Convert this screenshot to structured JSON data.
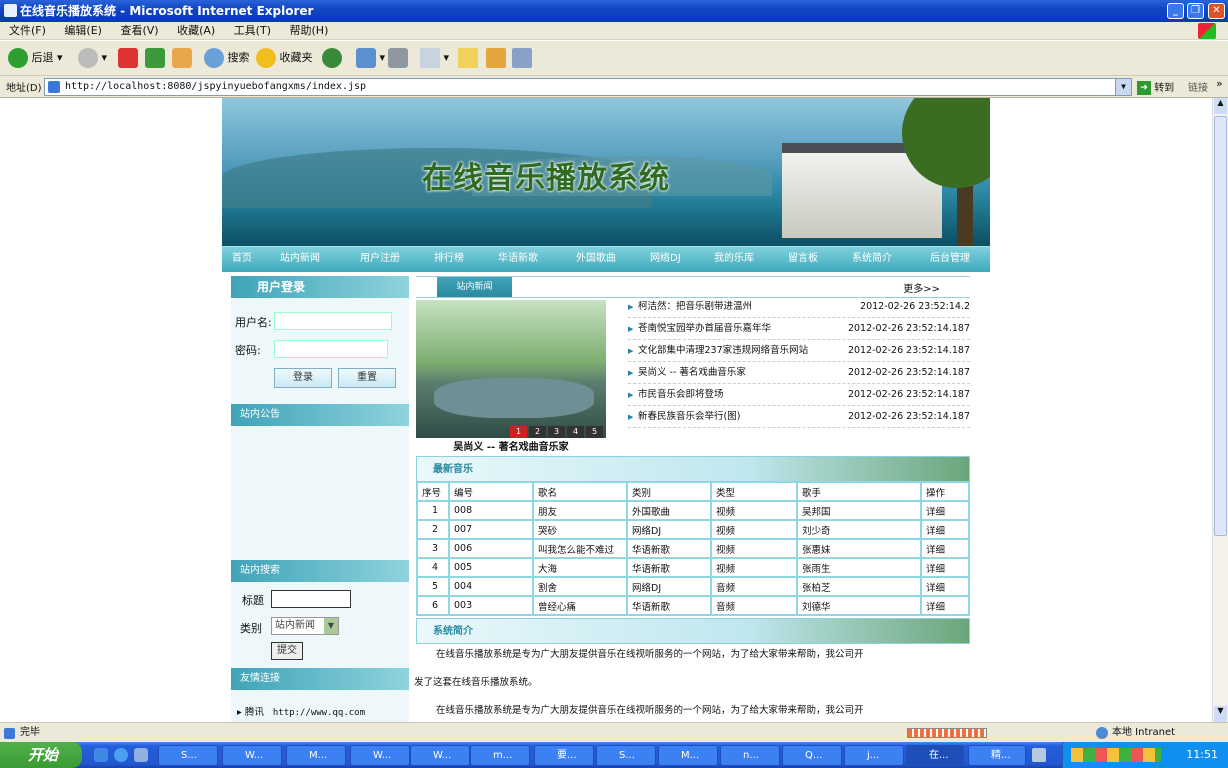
{
  "window": {
    "title": "在线音乐播放系统 - Microsoft Internet Explorer"
  },
  "menu": [
    "文件(F)",
    "编辑(E)",
    "查看(V)",
    "收藏(A)",
    "工具(T)",
    "帮助(H)"
  ],
  "toolbar": {
    "back": "后退",
    "search": "搜索",
    "favorites": "收藏夹"
  },
  "address": {
    "label": "地址(D)",
    "url": "http://localhost:8080/jspyinyuebofangxms/index.jsp",
    "go": "转到",
    "links": "链接"
  },
  "site": {
    "banner_title": "在线音乐播放系统",
    "nav": [
      "首页",
      "站内新闻",
      "用户注册",
      "排行榜",
      "华语新歌",
      "外国歌曲",
      "网络DJ",
      "我的乐库",
      "留言板",
      "系统简介",
      "后台管理"
    ],
    "login": {
      "header": "用户登录",
      "username_label": "用户名:",
      "password_label": "密码:",
      "login_btn": "登录",
      "reset_btn": "重置"
    },
    "notice": {
      "header": "站内公告"
    },
    "search": {
      "header": "站内搜索",
      "title_label": "标题",
      "category_label": "类别",
      "category_value": "站内新闻",
      "submit": "提交"
    },
    "links": {
      "header": "友情连接",
      "items": [
        {
          "name": "腾讯",
          "url": "http://www.qq.com"
        }
      ]
    },
    "news": {
      "tab": "站内新闻",
      "more": "更多>>",
      "caption": "吴尚义 -- 著名戏曲音乐家",
      "pages": [
        "1",
        "2",
        "3",
        "4",
        "5"
      ],
      "items": [
        {
          "title": "柯洁然：把音乐剧带进温州",
          "date": "2012-02-26 23:52:14.2"
        },
        {
          "title": "苍南悦宝园举办首届音乐嘉年华",
          "date": "2012-02-26 23:52:14.187"
        },
        {
          "title": "文化部集中清理237家违规网络音乐网站",
          "date": "2012-02-26 23:52:14.187"
        },
        {
          "title": "吴尚义 -- 著名戏曲音乐家",
          "date": "2012-02-26 23:52:14.187"
        },
        {
          "title": "市民音乐会即将登场",
          "date": "2012-02-26 23:52:14.187"
        },
        {
          "title": "新春民族音乐会举行(图)",
          "date": "2012-02-26 23:52:14.187"
        }
      ]
    },
    "music": {
      "header": "最新音乐",
      "columns": [
        "序号",
        "编号",
        "歌名",
        "类别",
        "类型",
        "歌手",
        "操作"
      ],
      "rows": [
        [
          "1",
          "008",
          "朋友",
          "外国歌曲",
          "视频",
          "吴邦国",
          "详细"
        ],
        [
          "2",
          "007",
          "哭砂",
          "网络DJ",
          "视频",
          "刘少奇",
          "详细"
        ],
        [
          "3",
          "006",
          "叫我怎么能不难过",
          "华语新歌",
          "视频",
          "张惠妹",
          "详细"
        ],
        [
          "4",
          "005",
          "大海",
          "华语新歌",
          "视频",
          "张雨生",
          "详细"
        ],
        [
          "5",
          "004",
          "割舍",
          "网络DJ",
          "音频",
          "张柏芝",
          "详细"
        ],
        [
          "6",
          "003",
          "曾经心痛",
          "华语新歌",
          "音频",
          "刘德华",
          "详细"
        ]
      ]
    },
    "intro": {
      "header": "系统简介",
      "p1a": "在线音乐播放系统是专为广大朋友提供音乐在线视听服务的一个网站，为了给大家带来帮助，我公司开",
      "p1b": "发了这套在线音乐播放系统。",
      "p2": "在线音乐播放系统是专为广大朋友提供音乐在线视听服务的一个网站，为了给大家带来帮助，我公司开"
    }
  },
  "status": {
    "text": "完毕",
    "zone": "本地 Intranet"
  },
  "taskbar": {
    "start": "开始",
    "clock": "11:51",
    "buttons": [
      "S...",
      "W...",
      "M...",
      "W...",
      "W...",
      "m...",
      "要...",
      "S...",
      "M...",
      "n...",
      "Q...",
      "j...",
      "在...",
      "精..."
    ]
  }
}
